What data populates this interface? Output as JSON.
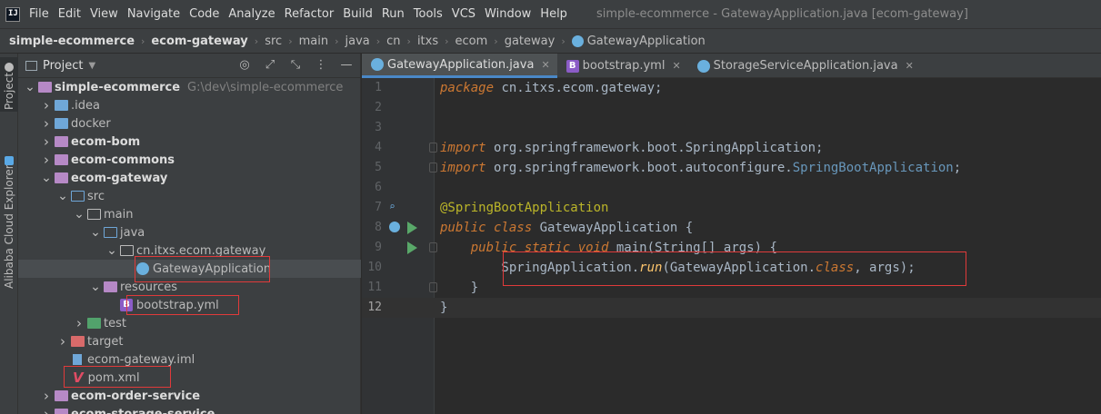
{
  "menubar": {
    "logo_text": "IJ",
    "items": [
      "File",
      "Edit",
      "View",
      "Navigate",
      "Code",
      "Analyze",
      "Refactor",
      "Build",
      "Run",
      "Tools",
      "VCS",
      "Window",
      "Help"
    ],
    "window_title": "simple-ecommerce - GatewayApplication.java [ecom-gateway]"
  },
  "breadcrumb": {
    "items": [
      "simple-ecommerce",
      "ecom-gateway",
      "src",
      "main",
      "java",
      "cn",
      "itxs",
      "ecom",
      "gateway",
      "GatewayApplication"
    ]
  },
  "toolstrip": {
    "project_tab": "Project",
    "cloud_tab": "Alibaba Cloud Explorer"
  },
  "project_panel": {
    "title": "Project",
    "tree": [
      {
        "label": "simple-ecommerce",
        "hint": "G:\\dev\\simple-ecommerce",
        "bold": true,
        "arrow": "down",
        "icon": "folder-mod",
        "depth": 0
      },
      {
        "label": ".idea",
        "arrow": "right",
        "icon": "folder-idea",
        "depth": 1
      },
      {
        "label": "docker",
        "arrow": "right",
        "icon": "folder-docker",
        "depth": 1
      },
      {
        "label": "ecom-bom",
        "bold": true,
        "arrow": "right",
        "icon": "folder-mod",
        "depth": 1
      },
      {
        "label": "ecom-commons",
        "bold": true,
        "arrow": "right",
        "icon": "folder-mod",
        "depth": 1
      },
      {
        "label": "ecom-gateway",
        "bold": true,
        "arrow": "down",
        "icon": "folder-mod",
        "depth": 1
      },
      {
        "label": "src",
        "arrow": "down",
        "icon": "folder-src",
        "depth": 2
      },
      {
        "label": "main",
        "arrow": "down",
        "icon": "folder-plain",
        "depth": 3
      },
      {
        "label": "java",
        "arrow": "down",
        "icon": "folder-src",
        "depth": 4
      },
      {
        "label": "cn.itxs.ecom.gateway",
        "arrow": "down",
        "icon": "folder-pkg",
        "depth": 5
      },
      {
        "label": "GatewayApplication",
        "icon": "java-class",
        "depth": 6,
        "selected": true
      },
      {
        "label": "resources",
        "arrow": "down",
        "icon": "folder-res",
        "depth": 4
      },
      {
        "label": "bootstrap.yml",
        "icon": "yml",
        "depth": 5
      },
      {
        "label": "test",
        "arrow": "right",
        "icon": "folder-test",
        "depth": 3
      },
      {
        "label": "target",
        "arrow": "right",
        "icon": "folder-target",
        "depth": 2
      },
      {
        "label": "ecom-gateway.iml",
        "icon": "iml",
        "depth": 2
      },
      {
        "label": "pom.xml",
        "icon": "maven",
        "depth": 2
      },
      {
        "label": "ecom-order-service",
        "bold": true,
        "arrow": "right",
        "icon": "folder-mod",
        "depth": 1
      },
      {
        "label": "ecom-storage-service",
        "bold": true,
        "arrow": "right",
        "icon": "folder-mod",
        "depth": 1
      }
    ]
  },
  "editor": {
    "tabs": [
      {
        "label": "GatewayApplication.java",
        "icon": "java-class",
        "active": true
      },
      {
        "label": "bootstrap.yml",
        "icon": "yml",
        "active": false
      },
      {
        "label": "StorageServiceApplication.java",
        "icon": "java-class",
        "active": false
      }
    ],
    "lines": [
      {
        "n": "1",
        "tokens": [
          [
            "kw",
            "package"
          ],
          [
            "pkgtext",
            " cn.itxs.ecom.gateway;"
          ]
        ]
      },
      {
        "n": "2",
        "tokens": []
      },
      {
        "n": "3",
        "tokens": []
      },
      {
        "n": "4",
        "tokens": [
          [
            "kw",
            "import"
          ],
          [
            "pkgtext",
            " org.springframework.boot.SpringApplication;"
          ]
        ]
      },
      {
        "n": "5",
        "tokens": [
          [
            "kw",
            "import"
          ],
          [
            "pkgtext",
            " org.springframework.boot.autoconfigure."
          ],
          [
            "ann-cls",
            "SpringBootApplication"
          ],
          [
            "pkgtext",
            ";"
          ]
        ]
      },
      {
        "n": "6",
        "tokens": []
      },
      {
        "n": "7",
        "tokens": [
          [
            "ann",
            "@SpringBootApplication"
          ]
        ]
      },
      {
        "n": "8",
        "tokens": [
          [
            "kw",
            "public class "
          ],
          [
            "cls",
            "GatewayApplication"
          ],
          [
            "pkgtext",
            " {"
          ]
        ]
      },
      {
        "n": "9",
        "tokens": [
          [
            "kw",
            "    public static void "
          ],
          [
            "pkgtext",
            "main("
          ],
          [
            "cls",
            "String"
          ],
          [
            "pkgtext",
            "[] args) {"
          ]
        ]
      },
      {
        "n": "10",
        "tokens": [
          [
            "pkgtext",
            "        SpringApplication."
          ],
          [
            "fn-italic",
            "run"
          ],
          [
            "pkgtext",
            "(GatewayApplication."
          ],
          [
            "kw",
            "class"
          ],
          [
            "pkgtext",
            ", args);"
          ]
        ]
      },
      {
        "n": "11",
        "tokens": [
          [
            "pkgtext",
            "    }"
          ]
        ]
      },
      {
        "n": "12",
        "tokens": [
          [
            "pkgtext",
            "}"
          ]
        ]
      }
    ]
  },
  "colors": {
    "accent": "#4a88c7",
    "highlight_box": "#e03a3a",
    "background": "#2b2b2b",
    "panel": "#3c3f41"
  }
}
